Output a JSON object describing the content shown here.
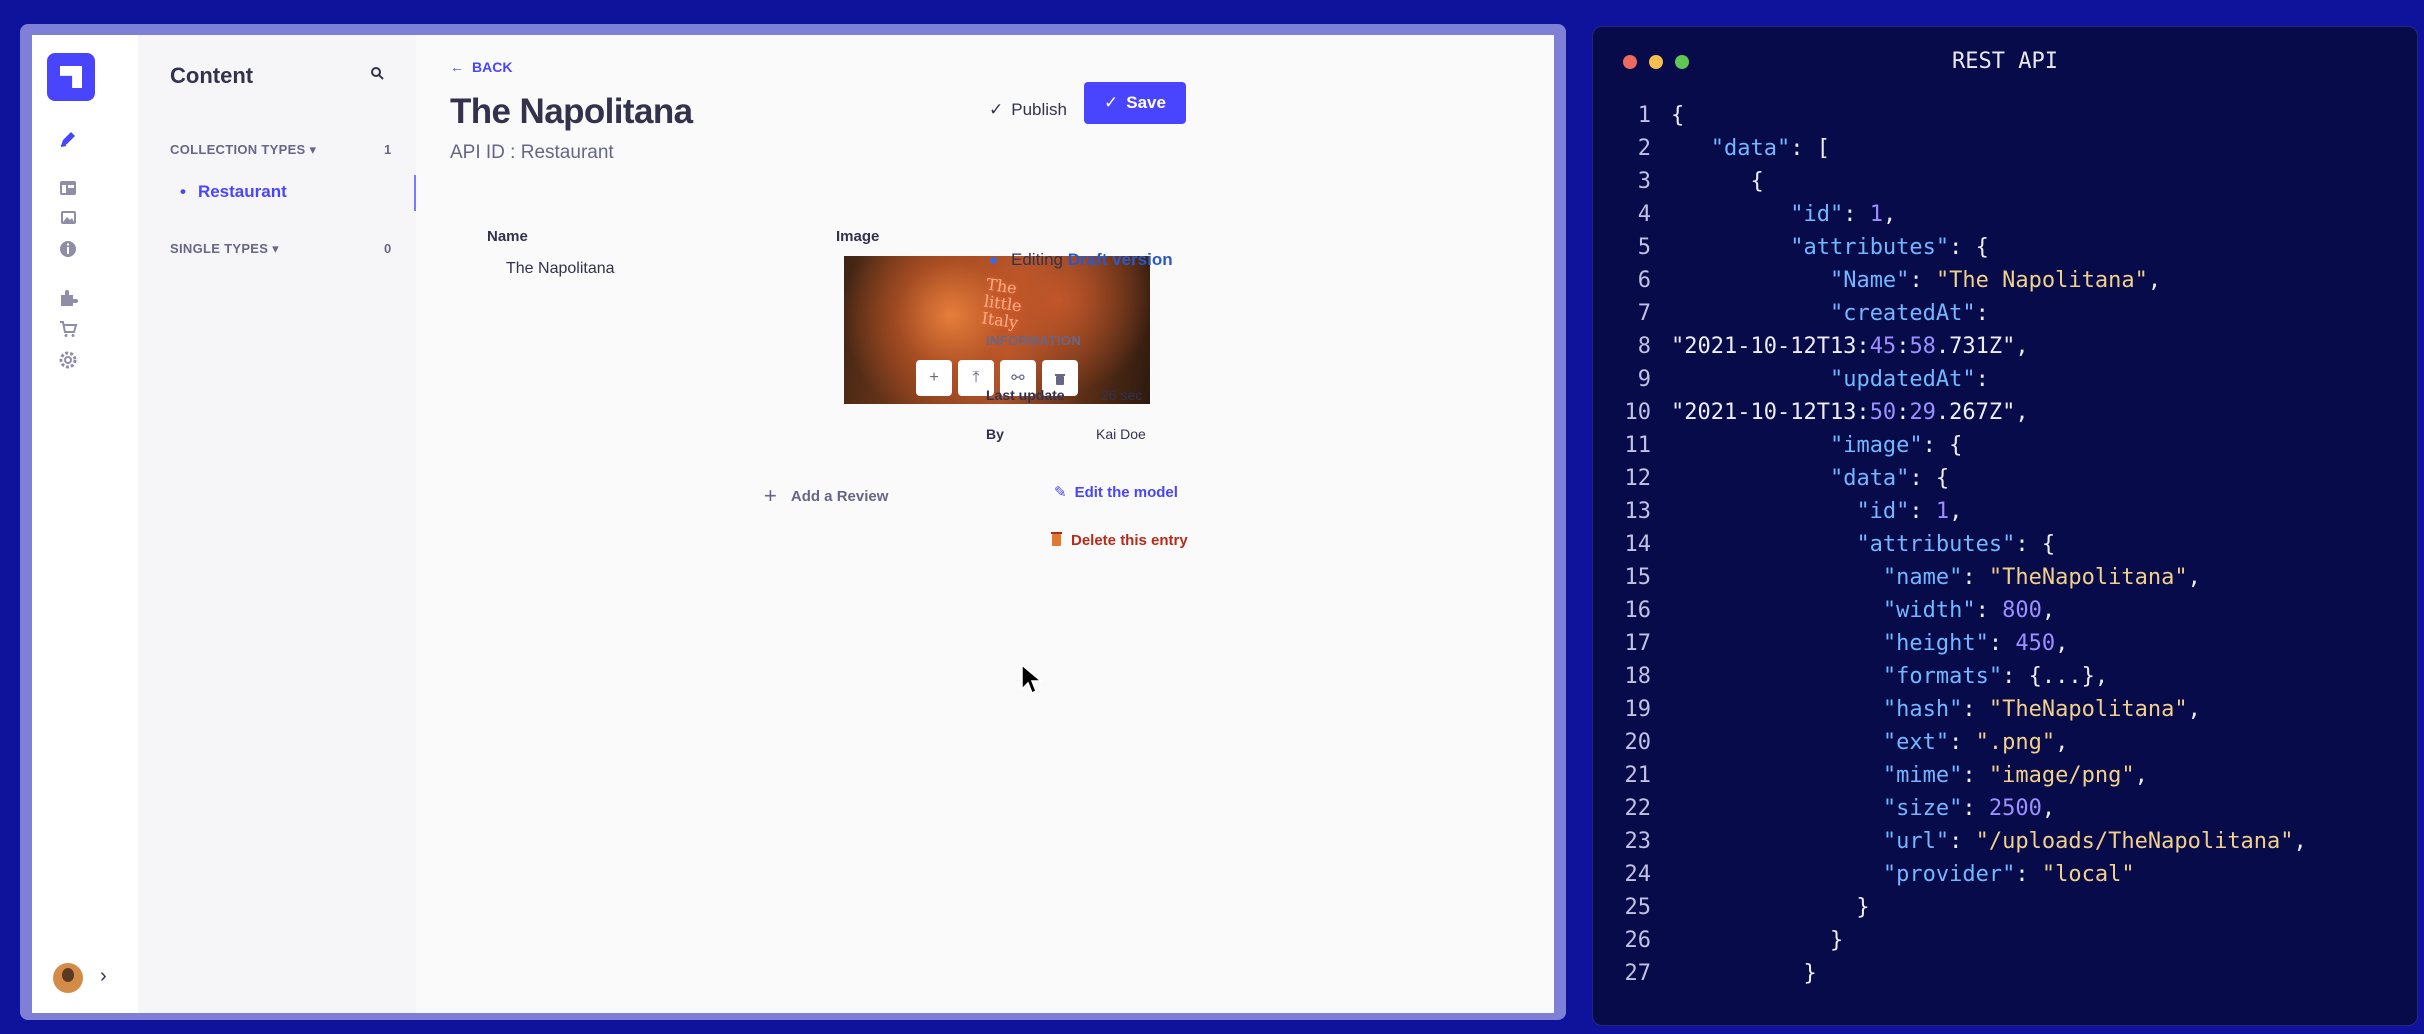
{
  "app": {
    "rail_icons": [
      "content-manager-icon",
      "builder-icon",
      "media-library-icon",
      "info-icon",
      "plugins-icon",
      "marketplace-icon",
      "settings-icon"
    ],
    "content_manager": {
      "title": "Content",
      "collection_types_label": "COLLECTION TYPES",
      "collection_types_count": "1",
      "collection_items": [
        "Restaurant"
      ],
      "single_types_label": "SINGLE TYPES",
      "single_types_count": "0"
    },
    "header": {
      "back_label": "BACK",
      "title": "The Napolitana",
      "api_id": "API ID : Restaurant",
      "publish_label": "Publish",
      "save_label": "Save"
    },
    "form": {
      "name_label": "Name",
      "name_value": "The Napolitana",
      "image_label": "Image",
      "image_neon_text": "The\nlittle\nItaly",
      "add_review_label": "Add a Review"
    },
    "panel": {
      "editing_prefix": "Editing",
      "editing_version": "Draft version",
      "info_title": "INFORMATION",
      "last_update_label": "Last update",
      "last_update_value": "26 sec",
      "by_label": "By",
      "by_value": "Kai Doe",
      "edit_model_label": "Edit the model",
      "delete_entry_label": "Delete this entry"
    },
    "colors": {
      "primary": "#4945ff",
      "danger": "#b72b1a"
    }
  },
  "code_window": {
    "title": "REST API",
    "window_dots": [
      "#ed6a5e",
      "#f5bf4f",
      "#62c554"
    ],
    "lines": [
      "{",
      "   \"data\": [",
      "      {",
      "         \"id\": 1,",
      "         \"attributes\": {",
      "            \"Name\": \"The Napolitana\",",
      "            \"createdAt\":",
      "\"2021-10-12T13:45:58.731Z\",",
      "            \"updatedAt\":",
      "\"2021-10-12T13:50:29.267Z\",",
      "            \"image\": {",
      "            \"data\": {",
      "              \"id\": 1,",
      "              \"attributes\": {",
      "                \"name\": \"TheNapolitana\",",
      "                \"width\": 800,",
      "                \"height\": 450,",
      "                \"formats\": {...},",
      "                \"hash\": \"TheNapolitana\",",
      "                \"ext\": \".png\",",
      "                \"mime\": \"image/png\",",
      "                \"size\": 2500,",
      "                \"url\": \"/uploads/TheNapolitana\",",
      "                \"provider\": \"local\"",
      "              }",
      "            }",
      "          }"
    ]
  }
}
